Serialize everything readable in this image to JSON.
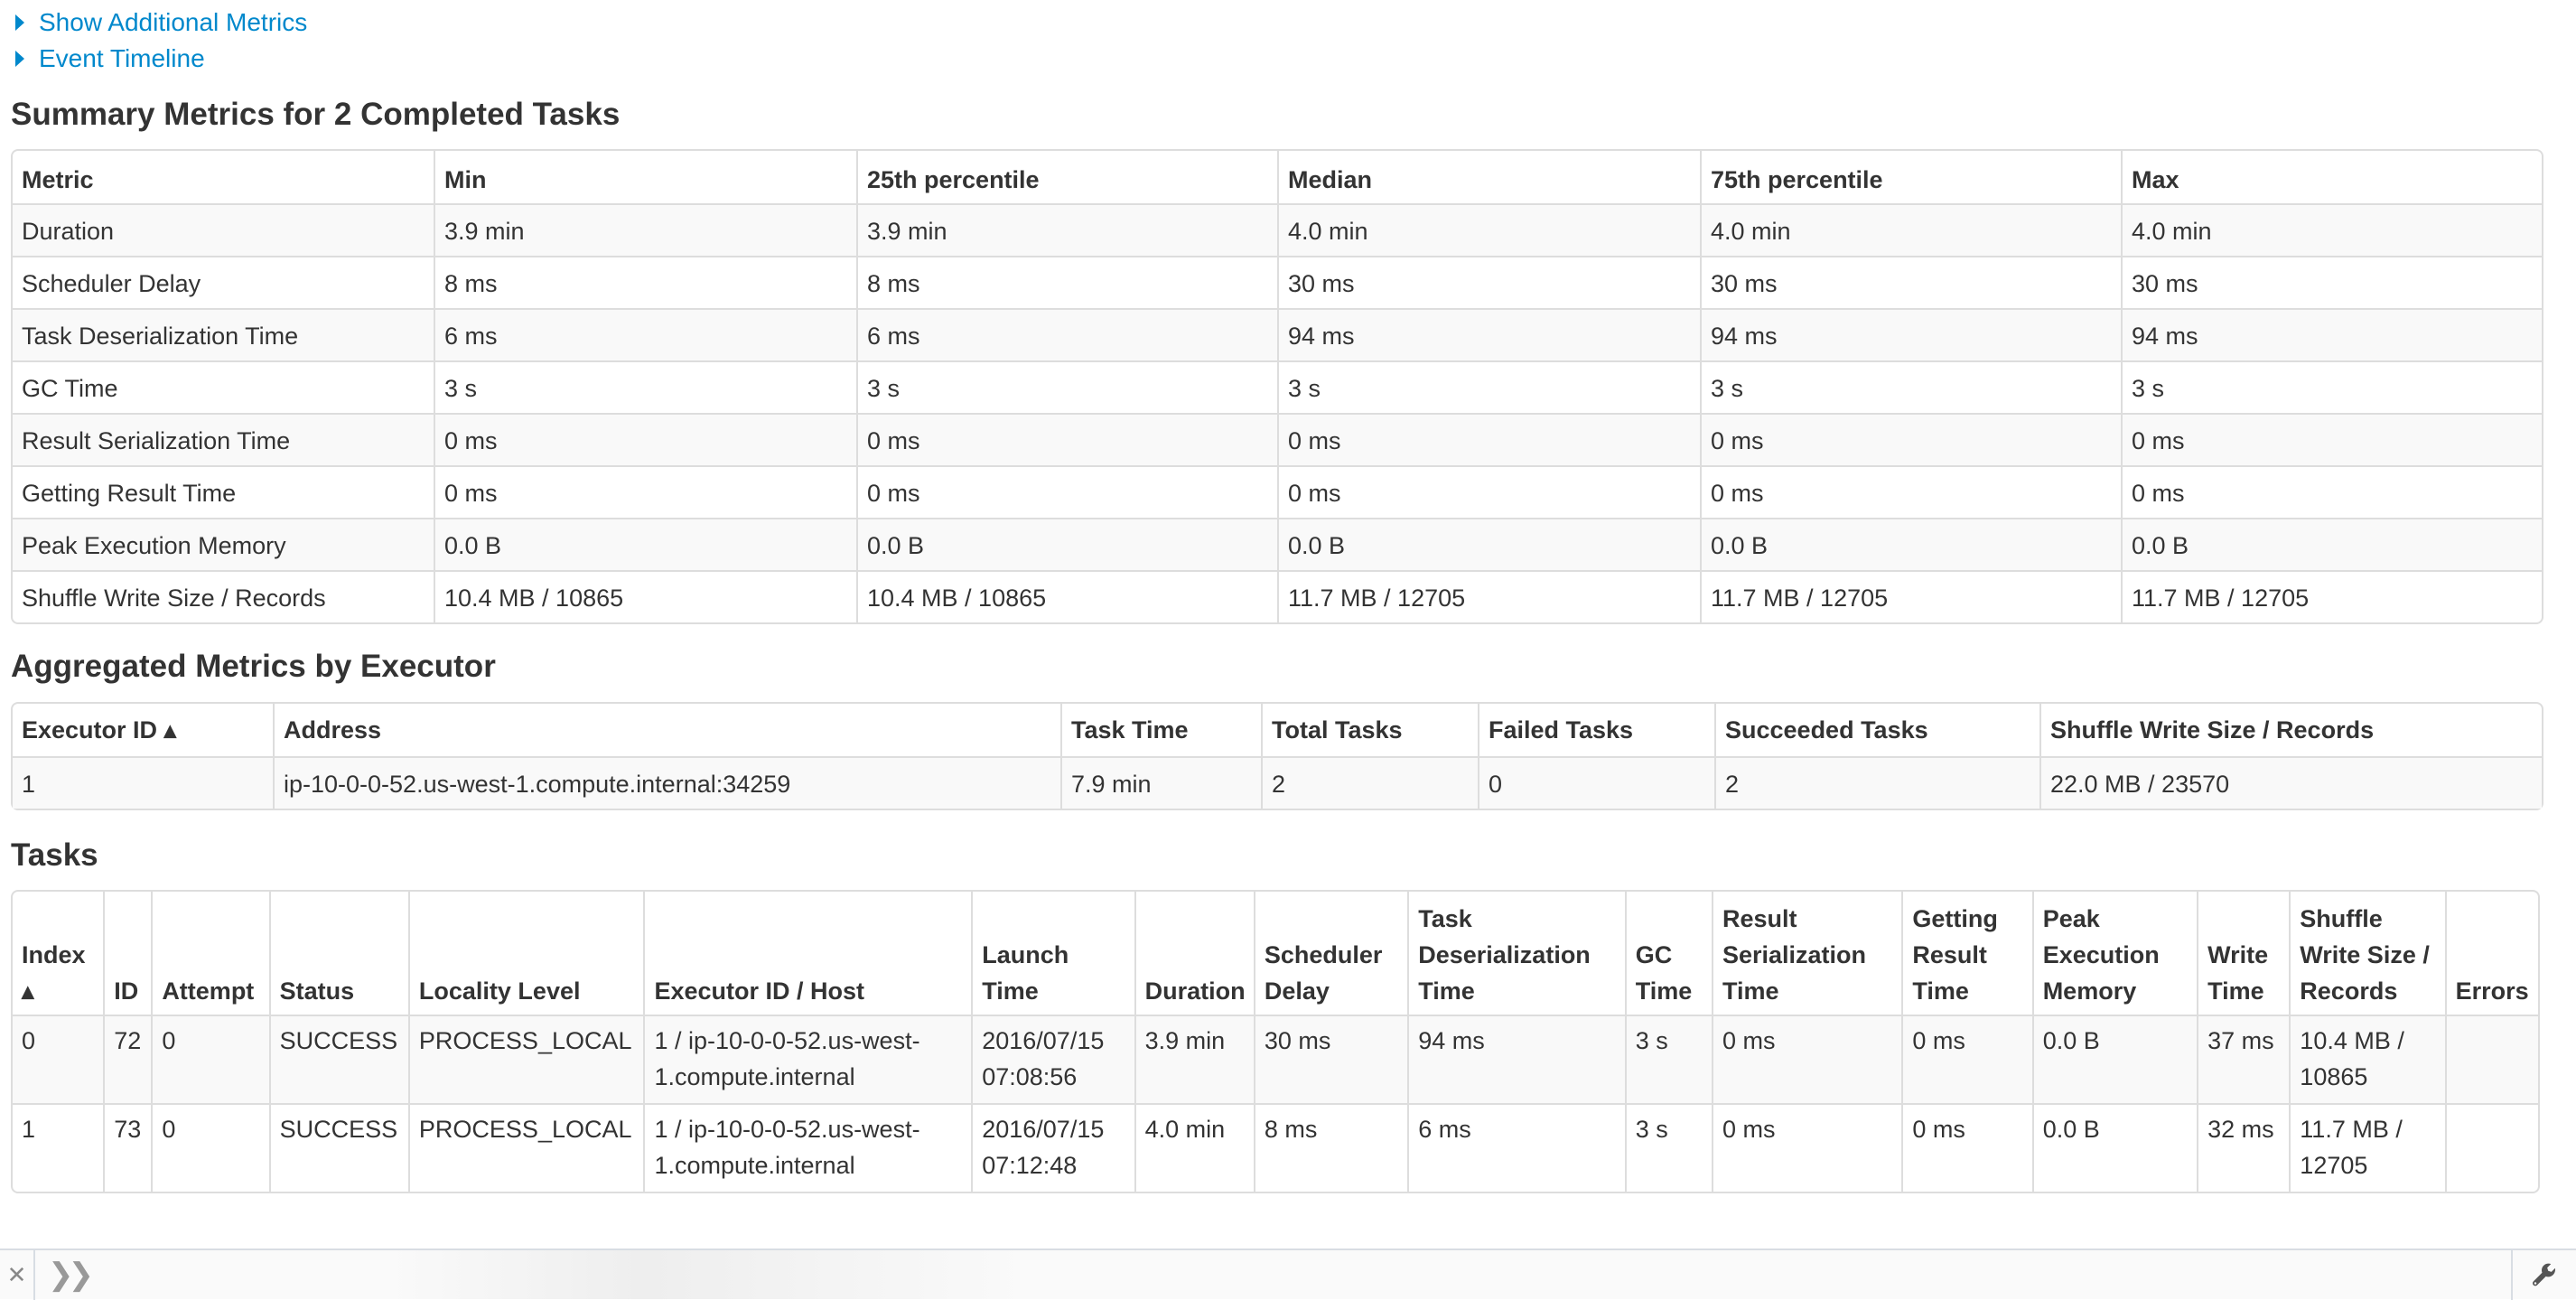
{
  "links": {
    "additional_metrics": "Show Additional Metrics",
    "event_timeline": "Event Timeline"
  },
  "summary": {
    "title": "Summary Metrics for 2 Completed Tasks",
    "headers": [
      "Metric",
      "Min",
      "25th percentile",
      "Median",
      "75th percentile",
      "Max"
    ],
    "rows": [
      [
        "Duration",
        "3.9 min",
        "3.9 min",
        "4.0 min",
        "4.0 min",
        "4.0 min"
      ],
      [
        "Scheduler Delay",
        "8 ms",
        "8 ms",
        "30 ms",
        "30 ms",
        "30 ms"
      ],
      [
        "Task Deserialization Time",
        "6 ms",
        "6 ms",
        "94 ms",
        "94 ms",
        "94 ms"
      ],
      [
        "GC Time",
        "3 s",
        "3 s",
        "3 s",
        "3 s",
        "3 s"
      ],
      [
        "Result Serialization Time",
        "0 ms",
        "0 ms",
        "0 ms",
        "0 ms",
        "0 ms"
      ],
      [
        "Getting Result Time",
        "0 ms",
        "0 ms",
        "0 ms",
        "0 ms",
        "0 ms"
      ],
      [
        "Peak Execution Memory",
        "0.0 B",
        "0.0 B",
        "0.0 B",
        "0.0 B",
        "0.0 B"
      ],
      [
        "Shuffle Write Size / Records",
        "10.4 MB / 10865",
        "10.4 MB / 10865",
        "11.7 MB / 12705",
        "11.7 MB / 12705",
        "11.7 MB / 12705"
      ]
    ]
  },
  "aggregated": {
    "title": "Aggregated Metrics by Executor",
    "headers": [
      "Executor ID ▴",
      "Address",
      "Task Time",
      "Total Tasks",
      "Failed Tasks",
      "Succeeded Tasks",
      "Shuffle Write Size / Records"
    ],
    "rows": [
      [
        "1",
        "ip-10-0-0-52.us-west-1.compute.internal:34259",
        "7.9 min",
        "2",
        "0",
        "2",
        "22.0 MB / 23570"
      ]
    ]
  },
  "tasks": {
    "title": "Tasks",
    "headers": [
      "Index ▴",
      "ID",
      "Attempt",
      "Status",
      "Locality Level",
      "Executor ID / Host",
      "Launch Time",
      "Duration",
      "Scheduler Delay",
      "Task Deserialization Time",
      "GC Time",
      "Result Serialization Time",
      "Getting Result Time",
      "Peak Execution Memory",
      "Write Time",
      "Shuffle Write Size / Records",
      "Errors"
    ],
    "rows": [
      [
        "0",
        "72",
        "0",
        "SUCCESS",
        "PROCESS_LOCAL",
        "1 / ip-10-0-0-52.us-west-1.compute.internal",
        "2016/07/15 07:08:56",
        "3.9 min",
        "30 ms",
        "94 ms",
        "3 s",
        "0 ms",
        "0 ms",
        "0.0 B",
        "37 ms",
        "10.4 MB / 10865",
        ""
      ],
      [
        "1",
        "73",
        "0",
        "SUCCESS",
        "PROCESS_LOCAL",
        "1 / ip-10-0-0-52.us-west-1.compute.internal",
        "2016/07/15 07:12:48",
        "4.0 min",
        "8 ms",
        "6 ms",
        "3 s",
        "0 ms",
        "0 ms",
        "0.0 B",
        "32 ms",
        "11.7 MB / 12705",
        ""
      ]
    ]
  },
  "bottom_bar": {
    "close_icon": "close-icon",
    "prompt_icon": "chevrons-right-icon",
    "settings_icon": "wrench-icon"
  },
  "colors": {
    "link": "#0088cc",
    "text": "#333333",
    "border": "#dddddd",
    "stripe": "#f9f9f9"
  }
}
